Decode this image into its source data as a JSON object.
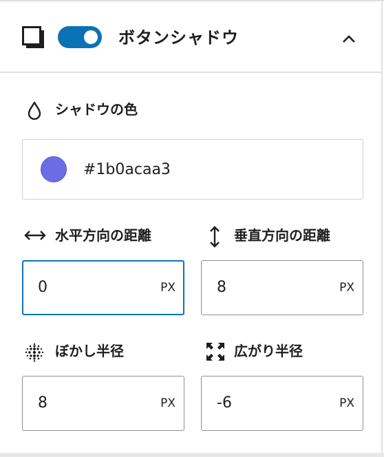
{
  "header": {
    "title": "ボタンシャドウ",
    "toggle_on": true,
    "icons": {
      "shadow": "box-shadow-icon",
      "collapse": "chevron-up-icon"
    }
  },
  "shadow_color": {
    "label": "シャドウの色",
    "icon": "droplet-icon",
    "value": "#1b0acaa3",
    "swatch_color": "#6c6ce6"
  },
  "horizontal_offset": {
    "label": "水平方向の距離",
    "icon": "horizontal-arrows-icon",
    "value": "0",
    "unit": "PX"
  },
  "vertical_offset": {
    "label": "垂直方向の距離",
    "icon": "vertical-arrows-icon",
    "value": "8",
    "unit": "PX"
  },
  "blur_radius": {
    "label": "ぼかし半径",
    "icon": "blur-dots-icon",
    "value": "8",
    "unit": "PX"
  },
  "spread_radius": {
    "label": "広がり半径",
    "icon": "expand-corners-icon",
    "value": "-6",
    "unit": "PX"
  },
  "colors": {
    "accent": "#0b73b5",
    "border": "#e0e0e0"
  }
}
